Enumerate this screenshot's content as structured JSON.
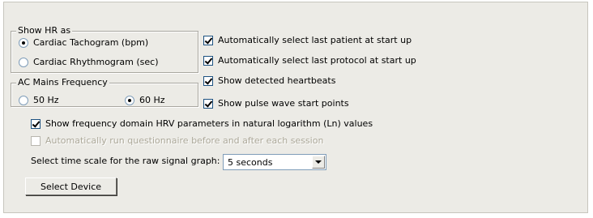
{
  "hr_group": {
    "title": "Show HR as",
    "options": [
      {
        "label": "Cardiac Tachogram (bpm)",
        "selected": true
      },
      {
        "label": "Cardiac Rhythmogram (sec)",
        "selected": false
      }
    ]
  },
  "mains_group": {
    "title": "AC Mains Frequency",
    "options": [
      {
        "label": "50 Hz",
        "selected": false
      },
      {
        "label": "60 Hz",
        "selected": true
      }
    ]
  },
  "checkboxes": {
    "auto_patient": {
      "label": "Automatically select last patient at start up",
      "checked": true
    },
    "auto_protocol": {
      "label": "Automatically select last protocol at start up",
      "checked": true
    },
    "show_heartbeats": {
      "label": "Show detected heartbeats",
      "checked": true
    },
    "show_pulse_wave": {
      "label": "Show pulse wave start points",
      "checked": true
    },
    "ln_values": {
      "label": "Show frequency domain HRV parameters in natural  logarithm (Ln) values",
      "checked": true
    },
    "questionnaire": {
      "label": "Automatically run questionnaire before and after each session",
      "checked": false,
      "disabled": true
    }
  },
  "time_scale": {
    "label": "Select time scale for the raw signal graph:",
    "value": "5 seconds"
  },
  "select_device_button": "Select Device",
  "colors": {
    "panel_bg": "#ecebe6",
    "disabled_text": "#aca899",
    "input_border": "#7f9db9"
  }
}
